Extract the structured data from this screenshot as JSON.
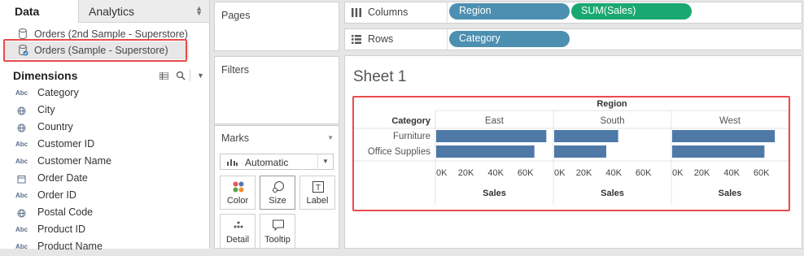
{
  "tabs": {
    "data": "Data",
    "analytics": "Analytics"
  },
  "datasources": [
    {
      "label": "Orders (2nd Sample - Superstore)"
    },
    {
      "label": "Orders (Sample - Superstore)"
    }
  ],
  "dimensions": {
    "title": "Dimensions",
    "fields": [
      {
        "label": "Category",
        "type": "Abc"
      },
      {
        "label": "City",
        "type": "globe"
      },
      {
        "label": "Country",
        "type": "globe"
      },
      {
        "label": "Customer ID",
        "type": "Abc"
      },
      {
        "label": "Customer Name",
        "type": "Abc"
      },
      {
        "label": "Order Date",
        "type": "calendar"
      },
      {
        "label": "Order ID",
        "type": "Abc"
      },
      {
        "label": "Postal Code",
        "type": "globe"
      },
      {
        "label": "Product ID",
        "type": "Abc"
      },
      {
        "label": "Product Name",
        "type": "Abc"
      }
    ]
  },
  "panels": {
    "pages": "Pages",
    "filters": "Filters",
    "marks": "Marks"
  },
  "marks": {
    "type": "Automatic",
    "cards": [
      "Color",
      "Size",
      "Label",
      "Detail",
      "Tooltip"
    ]
  },
  "shelves": {
    "columns_label": "Columns",
    "rows_label": "Rows",
    "columns_pills": [
      "Region",
      "SUM(Sales)"
    ],
    "rows_pills": [
      "Category"
    ]
  },
  "colors": {
    "dimension_pill": "#4d8fb0",
    "measure_pill": "#19a870",
    "bar": "#4e79a7",
    "highlight": "#e84c4c"
  },
  "sheet": {
    "title": "Sheet 1"
  },
  "chart_data": {
    "type": "bar",
    "orientation": "horizontal",
    "column_header": "Region",
    "row_header": "Category",
    "regions": [
      "East",
      "South",
      "West"
    ],
    "categories": [
      "Furniture",
      "Office Supplies"
    ],
    "values": {
      "East": [
        74000,
        66000
      ],
      "South": [
        43000,
        35000
      ],
      "West": [
        69000,
        62000
      ]
    },
    "xlim": [
      0,
      70000
    ],
    "ticks": [
      "0K",
      "20K",
      "40K",
      "60K"
    ],
    "tick_values": [
      0,
      20000,
      40000,
      60000
    ],
    "xlabel": "Sales"
  }
}
